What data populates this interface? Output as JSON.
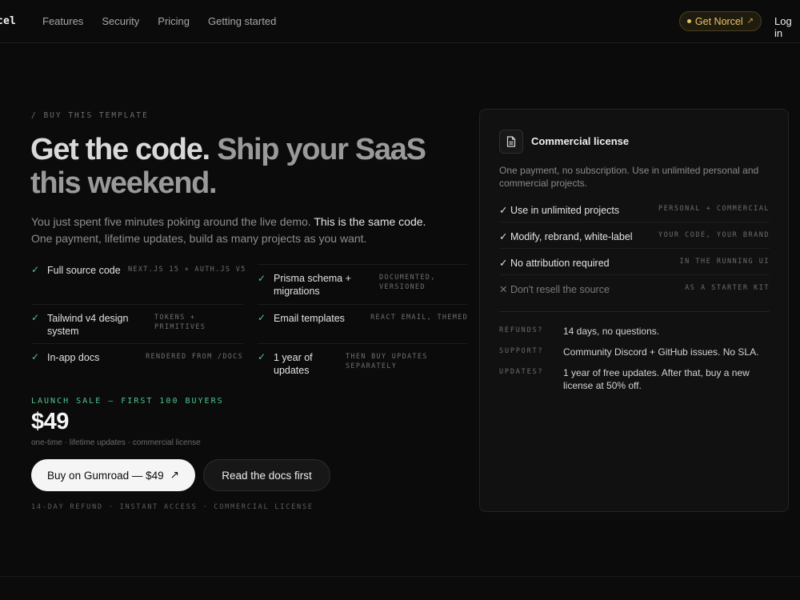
{
  "nav": {
    "brand": "cel",
    "links": [
      "Features",
      "Security",
      "Pricing",
      "Getting started"
    ],
    "cta": "Get Norcel",
    "cta_arrow": "↗",
    "login": "Log in"
  },
  "hero": {
    "eyebrow": "/ BUY THIS TEMPLATE",
    "headline_a": "Get the code.",
    "headline_b": "Ship your SaaS this weekend.",
    "lede_a": "You just spent five minutes poking around the live demo.",
    "lede_b": "This is the same code.",
    "lede_c": "One payment, lifetime updates, build as many projects as you want."
  },
  "features": [
    {
      "name": "Full source code",
      "tag": "NEXT.JS 15 + AUTH.JS V5",
      "check": "✓"
    },
    {
      "name": "Prisma schema + migrations",
      "tag": "DOCUMENTED, VERSIONED",
      "check": "✓"
    },
    {
      "name": "Tailwind v4 design system",
      "tag": "TOKENS + PRIMITIVES",
      "check": "✓"
    },
    {
      "name": "Email templates",
      "tag": "REACT EMAIL, THEMED",
      "check": "✓"
    },
    {
      "name": "In-app docs",
      "tag": "RENDERED FROM /DOCS",
      "check": "✓"
    },
    {
      "name": "1 year of updates",
      "tag": "THEN BUY UPDATES SEPARATELY",
      "check": "✓"
    }
  ],
  "pricing": {
    "sale_label": "LAUNCH SALE — FIRST 100 BUYERS",
    "price": "$49",
    "price_sub": "one-time · lifetime updates · commercial license",
    "buy_button": "Buy on Gumroad — $49",
    "buy_arrow": "↗",
    "docs_button": "Read the docs first",
    "fine_print": "14-DAY REFUND · INSTANT ACCESS · COMMERCIAL LICENSE"
  },
  "license_card": {
    "title": "Commercial license",
    "description": "One payment, no subscription. Use in unlimited personal and commercial projects.",
    "rows": [
      {
        "label": "✓ Use in unlimited projects",
        "tag": "PERSONAL + COMMERCIAL",
        "allowed": true
      },
      {
        "label": "✓ Modify, rebrand, white-label",
        "tag": "YOUR CODE, YOUR BRAND",
        "allowed": true
      },
      {
        "label": "✓ No attribution required",
        "tag": "IN THE RUNNING UI",
        "allowed": true
      },
      {
        "label": "✕ Don't resell the source",
        "tag": "AS A STARTER KIT",
        "allowed": false
      }
    ],
    "faq": [
      {
        "key": "REFUNDS?",
        "value": "14 days, no questions."
      },
      {
        "key": "SUPPORT?",
        "value": "Community Discord + GitHub issues. No SLA."
      },
      {
        "key": "UPDATES?",
        "value": "1 year of free updates. After that, buy a new license at 50% off."
      }
    ]
  },
  "colors": {
    "accent_green": "#4fc58e",
    "accent_gold": "#eac565",
    "background": "#0b0b0b"
  }
}
